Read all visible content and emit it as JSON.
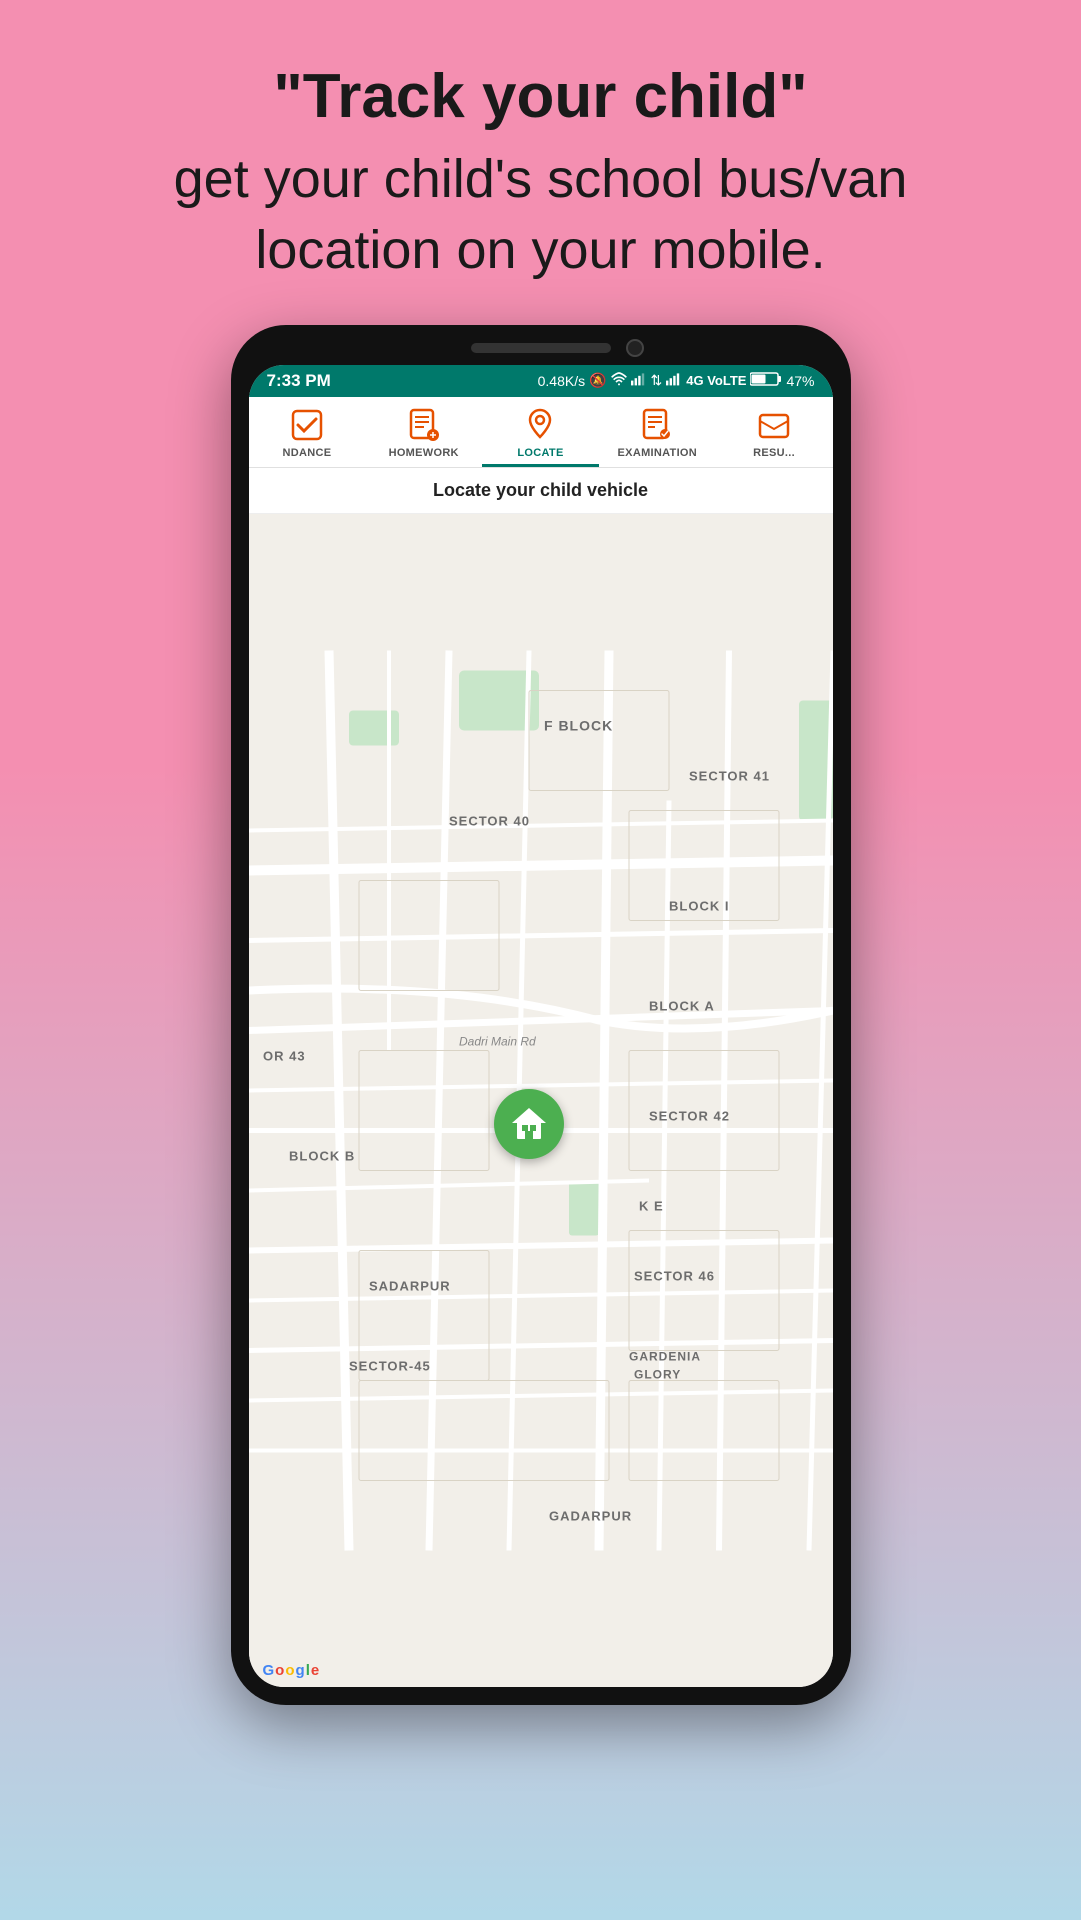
{
  "background_gradient": {
    "top_color": "#f48fb1",
    "bottom_color": "#b2d8e8"
  },
  "top_text": {
    "headline": "\"Track your child\"",
    "subtext": "get your child's school bus/van location on your mobile."
  },
  "status_bar": {
    "time": "7:33 PM",
    "speed": "0.48K/s",
    "network": "4G VoLTE",
    "battery": "47%",
    "background_color": "#00796B"
  },
  "nav_tabs": [
    {
      "id": "attendance",
      "label": "NDANCE",
      "icon": "check-square-icon",
      "active": false
    },
    {
      "id": "homework",
      "label": "HOMEWORK",
      "icon": "pencil-clipboard-icon",
      "active": false
    },
    {
      "id": "locate",
      "label": "LOCATE",
      "icon": "map-pin-icon",
      "active": true
    },
    {
      "id": "examination",
      "label": "EXAMINATION",
      "icon": "exam-clipboard-icon",
      "active": false
    },
    {
      "id": "result",
      "label": "RESU...",
      "icon": "mail-icon",
      "active": false
    }
  ],
  "map_section": {
    "header": "Locate your child vehicle",
    "map_labels": [
      {
        "id": "f-block",
        "text": "F BLOCK"
      },
      {
        "id": "sector-40",
        "text": "SECTOR 40"
      },
      {
        "id": "sector-41",
        "text": "SECTOR 41"
      },
      {
        "id": "sector-42",
        "text": "SECTOR 42"
      },
      {
        "id": "sector-43",
        "text": "OR 43"
      },
      {
        "id": "sector-45",
        "text": "SECTOR-45"
      },
      {
        "id": "sector-46",
        "text": "SECTOR 46"
      },
      {
        "id": "block-i",
        "text": "BLOCK I"
      },
      {
        "id": "block-a",
        "text": "BLOCK A"
      },
      {
        "id": "block-b",
        "text": "BLOCK B"
      },
      {
        "id": "block-e",
        "text": "K E"
      },
      {
        "id": "dadri-main-rd",
        "text": "Dadri Main Rd"
      },
      {
        "id": "sadarpur",
        "text": "SADARPUR"
      },
      {
        "id": "gardenia-glory",
        "text": "GARDENIA GLORY"
      },
      {
        "id": "gadarpur",
        "text": "GADARPUR"
      }
    ],
    "location_marker": {
      "icon": "school-bus-icon",
      "color": "#4CAF50"
    }
  },
  "google_branding": {
    "text": "Google",
    "colors": [
      "blue",
      "red",
      "yellow",
      "blue",
      "green",
      "red"
    ]
  }
}
